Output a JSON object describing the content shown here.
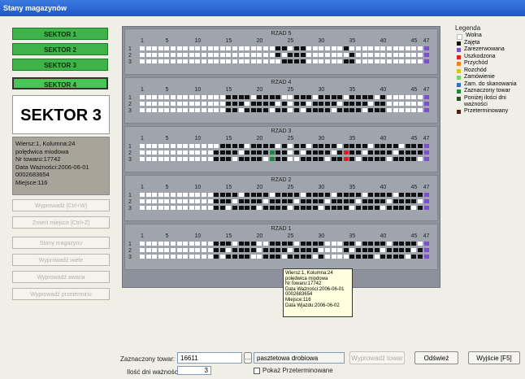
{
  "window": {
    "title": "Stany magazynów"
  },
  "sectors": [
    "SEKTOR 1",
    "SEKTOR 2",
    "SEKTOR 3",
    "SEKTOR 4"
  ],
  "current_sector": "SEKTOR 3",
  "info_lines": [
    "Wiersz:1, Kolumna:24",
    "polędwica miodowa",
    "Nr towaru:17742",
    "Data Ważności:2006-06-01",
    "0002683654",
    "Miejsce:116"
  ],
  "side_buttons": [
    "Wyprowadź [Ctrl+W]",
    "Zmień miejsce [Ctrl+Z]",
    "Stany magazynu",
    "Wyprowadź wiele",
    "Wyprowadź awaria",
    "Wyprowadź przeterminu"
  ],
  "column_numbers": [
    "1",
    "5",
    "10",
    "15",
    "20",
    "25",
    "30",
    "35",
    "40",
    "45",
    "47"
  ],
  "row_numbers": [
    "1",
    "2",
    "3"
  ],
  "rows": [
    {
      "title": "RZAD 5"
    },
    {
      "title": "RZAD 4"
    },
    {
      "title": "RZAD 3"
    },
    {
      "title": "RZAD 2"
    },
    {
      "title": "RZAD 1"
    }
  ],
  "legend": {
    "title": "Legenda",
    "items": [
      {
        "label": "Wolna",
        "color": "#ffffff"
      },
      {
        "label": "Zajęta",
        "color": "#111111"
      },
      {
        "label": "Zarezerwowana",
        "color": "#7b4fd0"
      },
      {
        "label": "Uszkodzona",
        "color": "#e02020"
      },
      {
        "label": "Przychód",
        "color": "#ff7d1a"
      },
      {
        "label": "Rozchód",
        "color": "#d9c41a"
      },
      {
        "label": "Zamówienie",
        "color": "#7fd06a"
      },
      {
        "label": "Zam. do skanowania",
        "color": "#2f6fd0"
      },
      {
        "label": "Zaznaczony towar",
        "color": "#1a8a3a"
      },
      {
        "label": "Poniżej ilości dni ważności",
        "color": "#2a4d2a"
      },
      {
        "label": "Przeterminowany",
        "color": "#4a2010"
      }
    ]
  },
  "tooltip_lines": [
    "Wiersz:1, Kolumna:24",
    "polędwica miodowa",
    "Nr towaru:17742",
    "Data Ważności:2006-06-01",
    "0002683654",
    "Miejsce:116",
    "Data Wjazdu:2006-06-02"
  ],
  "footer": {
    "selected_label": "Zaznaczony towar:",
    "selected_value": "16611",
    "product_name": "pasztetowa drobiowa",
    "days_label": "Ilość dni ważności:",
    "days_value": "3",
    "show_expired_label": "Pokaż Przeterminowane",
    "wyprowadz_button": "Wyprowadź towar",
    "refresh_button": "Odśwież",
    "exit_button": "Wyjście [F5]"
  }
}
